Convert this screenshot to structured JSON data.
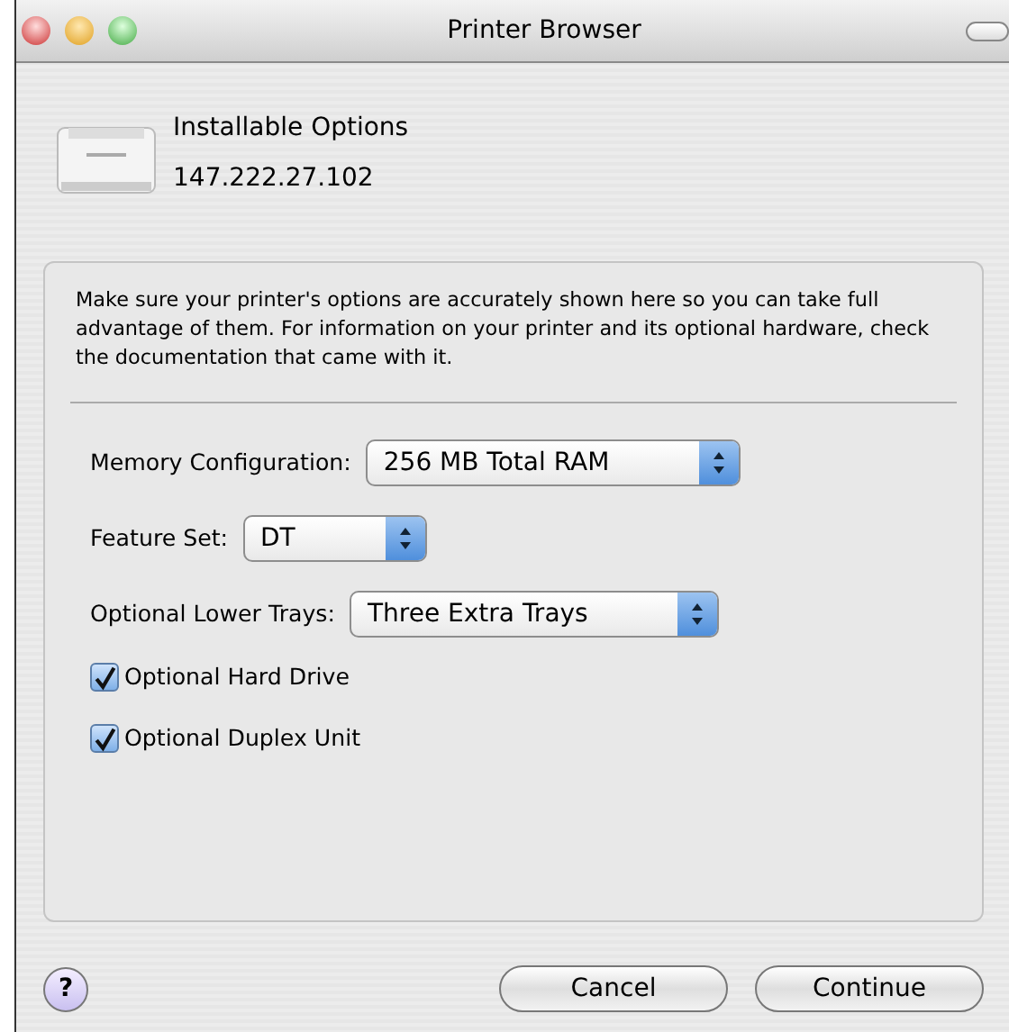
{
  "window": {
    "title": "Printer Browser"
  },
  "header": {
    "title": "Installable Options",
    "address": "147.222.27.102"
  },
  "description": "Make sure your printer's options are accurately shown here so you can take full advantage of them.  For information on your printer and its optional hardware, check the documentation that came with it.",
  "popups": [
    {
      "label": "Memory Configuration:",
      "value": "256 MB Total RAM"
    },
    {
      "label": "Feature Set:",
      "value": "DT"
    },
    {
      "label": "Optional Lower Trays:",
      "value": "Three Extra Trays"
    }
  ],
  "checkboxes": [
    {
      "label": "Optional Hard Drive",
      "checked": true
    },
    {
      "label": "Optional Duplex Unit",
      "checked": true
    }
  ],
  "buttons": [
    {
      "label": "?",
      "kind": "help"
    },
    {
      "label": "Cancel",
      "kind": "cancel"
    },
    {
      "label": "Continue",
      "kind": "default"
    }
  ]
}
